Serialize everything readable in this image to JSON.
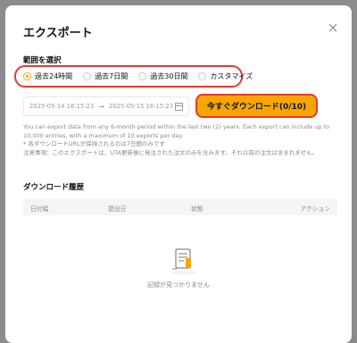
{
  "dialog": {
    "title": "エクスポート"
  },
  "range": {
    "label": "範囲を選択",
    "options": [
      {
        "label": "過去24時間",
        "selected": true
      },
      {
        "label": "過去7日間",
        "selected": false
      },
      {
        "label": "過去30日間",
        "selected": false
      },
      {
        "label": "カスタマイズ",
        "selected": false
      }
    ]
  },
  "date_range": {
    "start": "2025-05-14 16:15:23",
    "end": "2025-05-15 16:15:23"
  },
  "export_button": {
    "label": "今すぐダウンロード(0/10)"
  },
  "notes": {
    "line1": "You can export data from any 6-month period within the last two (2) years. Each export can include up to 10,000 entries, with a maximum of 10 exports per day.",
    "line2": "* 各ダウンロードURLが保持されるのは7日間のみです",
    "line3": "注意事項：このエクスポートは、UTA更新後に発注された注文のみを含みます。それ以前の注文は含まれません。"
  },
  "history": {
    "title": "ダウンロード履歴",
    "columns": [
      "日付幅",
      "提出日",
      "状態",
      "アクション"
    ],
    "empty_text": "記録が見つかりません"
  },
  "colors": {
    "accent": "#f7a600",
    "highlight": "#e8392f"
  }
}
